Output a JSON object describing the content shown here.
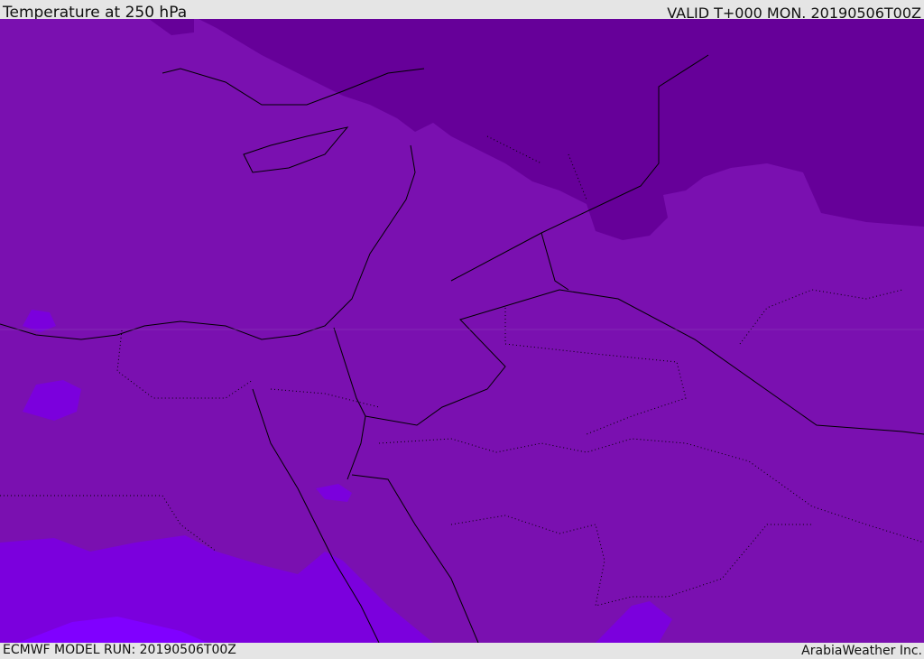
{
  "header": {
    "title": "Temperature at 250 hPa",
    "valid": "VALID T+000 MON. 20190506T00Z"
  },
  "footer": {
    "model_run": "ECMWF MODEL RUN: 20190506T00Z",
    "brand": "ArabiaWeather Inc."
  },
  "colors": {
    "base": "#7a10b0",
    "cold": "#660099",
    "warm": "#7b00dd",
    "warmest": "#8000ff",
    "border": "#000000"
  }
}
